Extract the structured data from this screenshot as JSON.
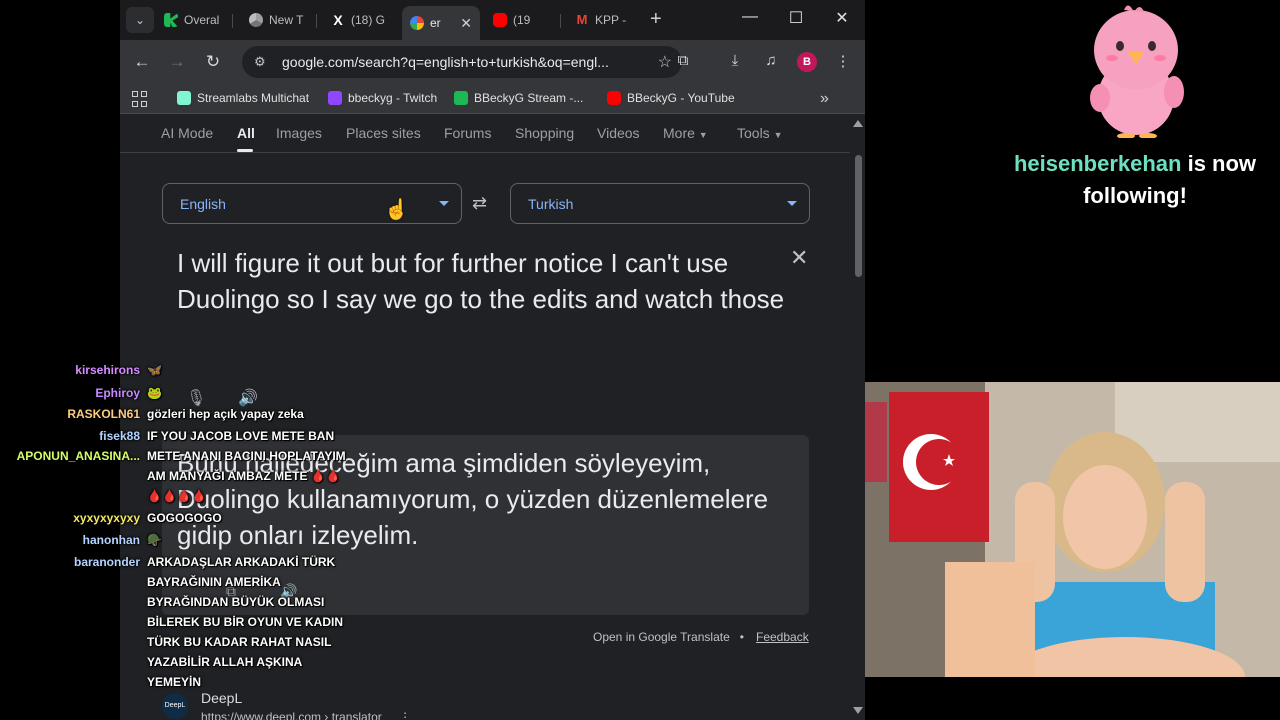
{
  "browser": {
    "tabs": [
      {
        "title": "Overal",
        "color": "#1db954"
      },
      {
        "title": "New T",
        "color": "#9e9e9e"
      },
      {
        "title": "(18) G",
        "color": "#ffffff"
      },
      {
        "title": "er",
        "color": "#4285f4"
      },
      {
        "title": "(19",
        "color": "#ff0000"
      },
      {
        "title": "KPP -",
        "color": "#ea4335"
      }
    ],
    "url": "google.com/search?q=english+to+turkish&oq=engl...",
    "profile_initial": "B",
    "bookmarks": [
      {
        "label": "Streamlabs Multichat",
        "color": "#80f5d2"
      },
      {
        "label": "bbeckyg - Twitch",
        "color": "#9146ff"
      },
      {
        "label": "BBeckyG Stream -...",
        "color": "#1db954"
      },
      {
        "label": "BBeckyG - YouTube",
        "color": "#ff0000"
      }
    ]
  },
  "search_tabs": [
    "AI Mode",
    "All",
    "Images",
    "Places sites",
    "Forums",
    "Shopping",
    "Videos",
    "More",
    "Tools"
  ],
  "translate": {
    "source_lang": "English",
    "target_lang": "Turkish",
    "source_text": "I will figure it out but for further notice I can't use Duolingo so I say we go to the edits and watch those",
    "target_text": "Bunu halledeceğim ama şimdiden söyleyeyim, Duolingo kullanamıyorum, o yüzden düzenlemelere gidip onları izleyelim.",
    "open_link": "Open in Google Translate",
    "bullet": "•",
    "feedback": "Feedback"
  },
  "result": {
    "name": "DeepL",
    "url": "https://www.deepl.com › translator",
    "logo_text": "DeepL"
  },
  "chat": [
    {
      "user": "kirsehirons",
      "color": "#d58cff",
      "msg": "🦋"
    },
    {
      "user": "Ephiroy",
      "color": "#c48bff",
      "msg": "🐸"
    },
    {
      "user": "RASKOLN61",
      "color": "#ffcc80",
      "msg": "gözleri hep açık yapay zeka"
    },
    {
      "user": "fisek88",
      "color": "#b3d4ff",
      "msg": "IF YOU JACOB LOVE METE BAN"
    },
    {
      "user": "APONUN_ANASINA...",
      "color": "#d4ff66",
      "msg": "METE ANANI BACINI HOPLATAYIM AM MANYAĞI AMBAZ METE 🩸🩸🩸🩸🩸🩸"
    },
    {
      "user": "xyxyxyxyxy",
      "color": "#f5e663",
      "msg": "GOGOGOGO"
    },
    {
      "user": "hanonhan",
      "color": "#b3d4ff",
      "msg": "🪖"
    },
    {
      "user": "baranonder",
      "color": "#b3d4ff",
      "msg": "ARKADAŞLAR ARKADAKİ TÜRK BAYRAĞININ AMERİKA BYRAĞINDAN BÜYÜK OLMASI BİLEREK BU BİR OYUN VE KADIN TÜRK BU KADAR RAHAT NASIL YAZABİLİR ALLAH AŞKINA YEMEYİN"
    }
  ],
  "alert": {
    "username": "heisenberkehan",
    "suffix": " is now following!"
  }
}
